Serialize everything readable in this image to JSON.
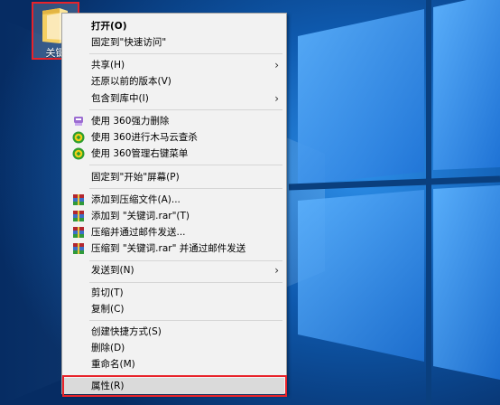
{
  "desktop": {
    "folder": {
      "label": "关键"
    }
  },
  "context_menu": {
    "items": [
      {
        "label": "打开(O)",
        "bold": true
      },
      {
        "label": "固定到\"快速访问\""
      },
      {
        "label": "共享(H)",
        "has_submenu": true
      },
      {
        "label": "还原以前的版本(V)"
      },
      {
        "label": "包含到库中(I)",
        "has_submenu": true
      },
      {
        "label": "使用 360强力删除",
        "icon": "360-shred-icon"
      },
      {
        "label": "使用 360进行木马云查杀",
        "icon": "360-security-icon"
      },
      {
        "label": "使用 360管理右键菜单",
        "icon": "360-security-icon"
      },
      {
        "label": "固定到\"开始\"屏幕(P)"
      },
      {
        "label": "添加到压缩文件(A)...",
        "icon": "winrar-icon"
      },
      {
        "label": "添加到 \"关键词.rar\"(T)",
        "icon": "winrar-icon"
      },
      {
        "label": "压缩并通过邮件发送...",
        "icon": "winrar-icon"
      },
      {
        "label": "压缩到 \"关键词.rar\" 并通过邮件发送",
        "icon": "winrar-icon"
      },
      {
        "label": "发送到(N)",
        "has_submenu": true
      },
      {
        "label": "剪切(T)"
      },
      {
        "label": "复制(C)"
      },
      {
        "label": "创建快捷方式(S)"
      },
      {
        "label": "删除(D)"
      },
      {
        "label": "重命名(M)"
      },
      {
        "label": "属性(R)",
        "selected": true
      }
    ]
  },
  "colors": {
    "highlight_outline": "#e8232a",
    "menu_background": "#f2f2f2",
    "desktop_background": "#0a3f7e"
  }
}
